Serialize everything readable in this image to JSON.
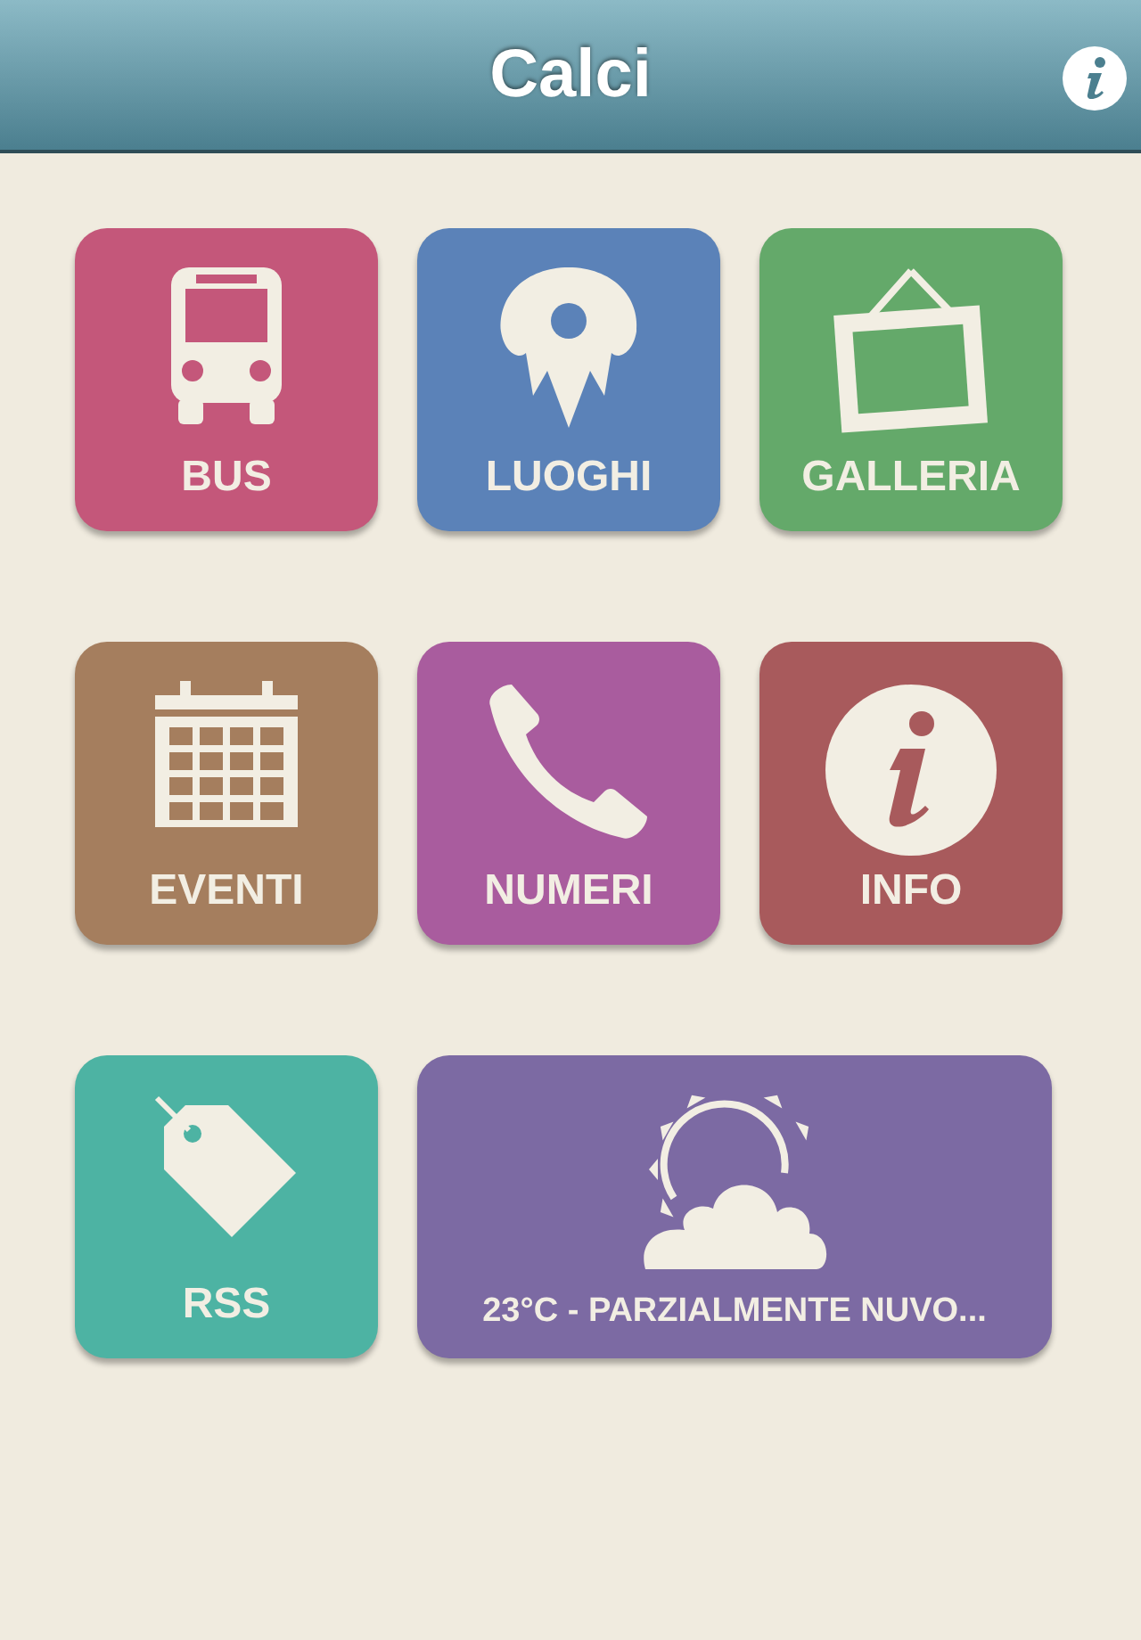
{
  "header": {
    "title": "Calci"
  },
  "tiles": [
    {
      "kind": "bus",
      "label": "BUS",
      "color": "#c4577a"
    },
    {
      "kind": "pin",
      "label": "LUOGHI",
      "color": "#5b82b8"
    },
    {
      "kind": "frame",
      "label": "GALLERIA",
      "color": "#64a96a"
    },
    {
      "kind": "calendar",
      "label": "EVENTI",
      "color": "#a57e5e"
    },
    {
      "kind": "phone",
      "label": "NUMERI",
      "color": "#a95c9e"
    },
    {
      "kind": "info",
      "label": "INFO",
      "color": "#a85a5c"
    },
    {
      "kind": "tag",
      "label": "RSS",
      "color": "#4db3a3"
    },
    {
      "kind": "weather",
      "label": "23°C - PARZIALMENTE NUVO...",
      "color": "#7c6aa3"
    }
  ]
}
